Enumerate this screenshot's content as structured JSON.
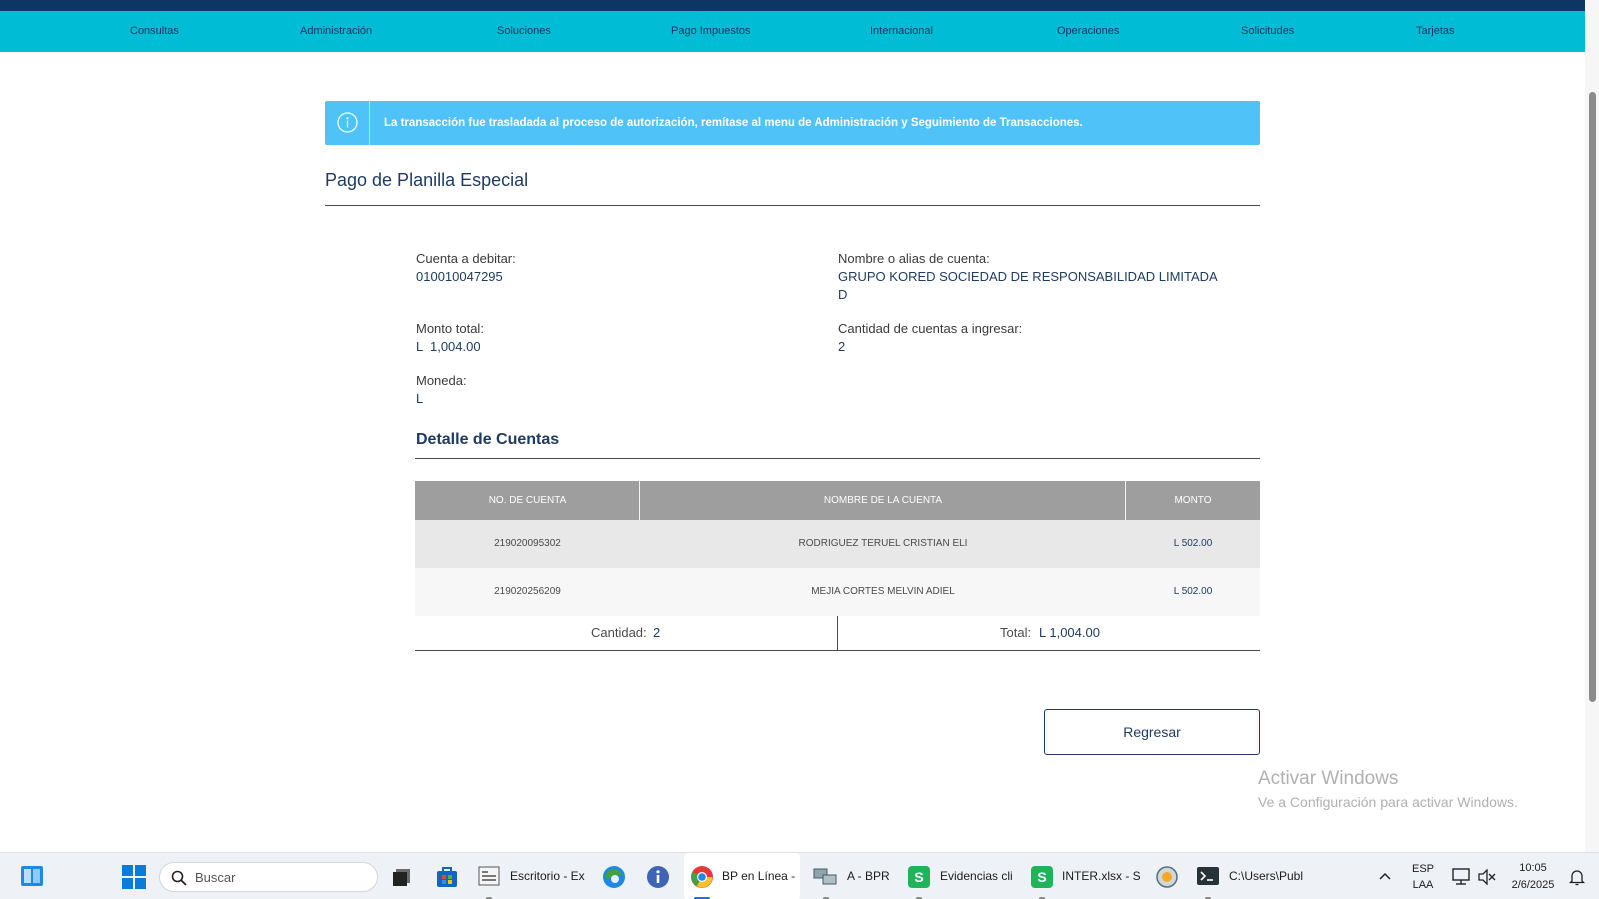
{
  "nav": {
    "items": [
      "Consultas",
      "Administración",
      "Soluciones",
      "Pago Impuestos",
      "Internacional",
      "Operaciones",
      "Solicitudes",
      "Tarjetas"
    ]
  },
  "alert": {
    "message": "La transacción fue trasladada al proceso de autorización, remítase al menu de Administración y Seguimiento de Transacciones."
  },
  "page": {
    "title": "Pago de Planilla Especial"
  },
  "summary": {
    "debit_account_label": "Cuenta a debitar:",
    "debit_account_value": "010010047295",
    "account_name_label": "Nombre o alias de cuenta:",
    "account_name_line1": "GRUPO KORED SOCIEDAD DE RESPONSABILIDAD LIMITADA",
    "account_name_line2": "D",
    "total_label": "Monto total:",
    "total_value": "L  1,004.00",
    "count_label": "Cantidad de cuentas a ingresar:",
    "count_value": "2",
    "currency_label": "Moneda:",
    "currency_value": "L"
  },
  "detail": {
    "title": "Detalle de Cuentas",
    "columns": [
      "NO. DE CUENTA",
      "NOMBRE DE LA CUENTA",
      "MONTO"
    ],
    "rows": [
      {
        "account": "219020095302",
        "name": "RODRIGUEZ TERUEL CRISTIAN ELI",
        "amount": "L 502.00"
      },
      {
        "account": "219020256209",
        "name": "MEJIA CORTES MELVIN ADIEL",
        "amount": "L 502.00"
      }
    ],
    "footer": {
      "count_label": "Cantidad:",
      "count_value": "2",
      "total_label": "Total:",
      "total_value": "L 1,004.00"
    }
  },
  "actions": {
    "back_label": "Regresar"
  },
  "watermark": {
    "line1": "Activar Windows",
    "line2": "Ve a Configuración para activar Windows."
  },
  "taskbar": {
    "search_placeholder": "Buscar",
    "apps": [
      {
        "icon": "file-explorer-icon",
        "label": "Escritorio - Ex"
      },
      {
        "icon": "chrome-icon",
        "label": "BP en Línea -"
      },
      {
        "icon": "remote-desktop-icon",
        "label": "A - BPR"
      },
      {
        "icon": "spreadsheet-icon",
        "label": "Evidencias cli"
      },
      {
        "icon": "spreadsheet-icon",
        "label": "INTER.xlsx - S"
      },
      {
        "icon": "terminal-icon",
        "label": "C:\\Users\\Publ"
      }
    ],
    "lang_line1": "ESP",
    "lang_line2": "LAA",
    "time": "10:05",
    "date": "2/6/2025"
  },
  "colors": {
    "nav_bg": "#00bcd4",
    "top_strip": "#0d3566",
    "alert_bg": "#4fc3f7",
    "primary_text": "#1f3b63",
    "table_header_bg": "#9e9e9e"
  }
}
